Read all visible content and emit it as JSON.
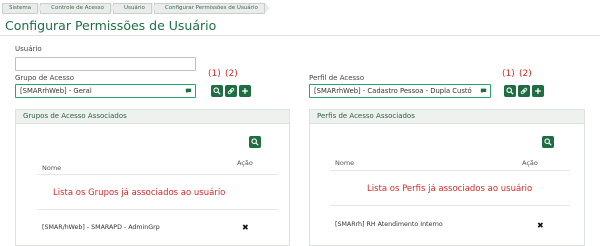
{
  "breadcrumb": [
    "Sistema",
    "Controle de Acesso",
    "Usuário",
    "Configurar Permissões de Usuário"
  ],
  "page_title": "Configurar Permissões de Usuário",
  "form": {
    "usuario_label": "Usuário",
    "usuario_value": "",
    "grupo_label": "Grupo de Acesso",
    "grupo_value": "[SMARrhWeb] - Geral",
    "perfil_label": "Perfil de Acesso",
    "perfil_value": "[SMARrhWeb] - Cadastro Pessoa - Dupla Custó"
  },
  "markers": {
    "one": "(1)",
    "two": "(2)"
  },
  "groups_panel": {
    "title": "Grupos de Acesso Associados",
    "col_nome": "Nome",
    "col_acao": "Ação",
    "info": "Lista os Grupos já associados ao usuário",
    "rows": [
      {
        "name": "[SMAR/hWeb] - SMARAPD - AdminGrp",
        "action": "✖"
      }
    ]
  },
  "profiles_panel": {
    "title": "Perfis de Acesso Associados",
    "col_nome": "Nome",
    "col_acao": "Ação",
    "info": "Lista os Perfis já associados ao usuário",
    "rows": [
      {
        "name": "[SMARrh] RH Atendimento Interno",
        "action": "✖"
      }
    ]
  },
  "icons": {
    "search": "search-icon",
    "link": "link-icon",
    "add": "plus-icon",
    "chat": "chat-bubble-icon"
  },
  "colors": {
    "brand": "#1f6e43",
    "accent": "#28a36a",
    "alert": "#d42a2a"
  }
}
